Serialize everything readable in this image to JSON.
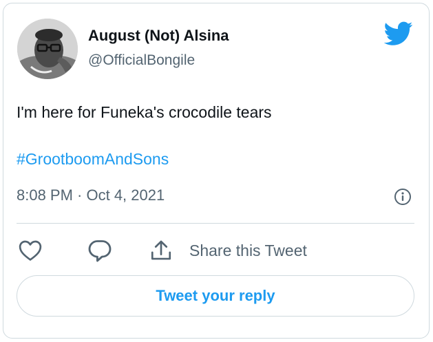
{
  "author": {
    "display_name": "August (Not) Alsina",
    "handle": "@OfficialBongile"
  },
  "tweet": {
    "text": "I'm here for Funeka's crocodile tears",
    "hashtag": "#GrootboomAndSons",
    "timestamp": "8:08 PM · Oct 4, 2021"
  },
  "actions": {
    "like_icon": "heart-icon",
    "reply_icon": "speech-bubble-icon",
    "share_icon": "share-upload-icon",
    "share_label": "Share this Tweet"
  },
  "reply_button": {
    "label": "Tweet your reply"
  },
  "colors": {
    "accent": "#1d9bf0",
    "text_primary": "#0f1419",
    "text_secondary": "#536471",
    "border": "#cfd9de"
  }
}
